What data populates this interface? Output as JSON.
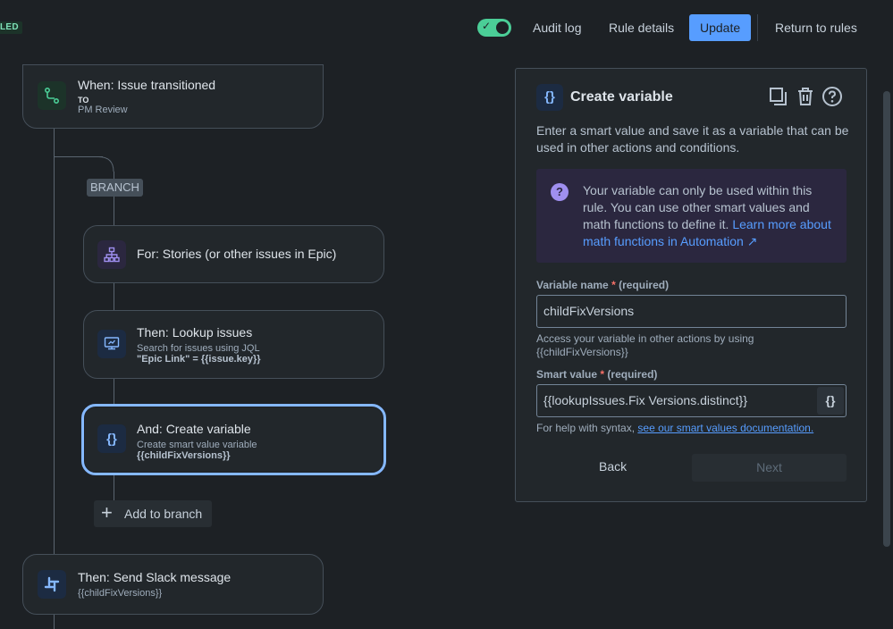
{
  "header": {
    "status_badge": "LED",
    "audit_log": "Audit log",
    "rule_details": "Rule details",
    "update": "Update",
    "return_to_rules": "Return to rules",
    "toggle_on": true,
    "toggle_check": "✓"
  },
  "flow": {
    "trigger": {
      "title": "When: Issue transitioned",
      "to_label": "TO",
      "status": "PM Review"
    },
    "branch_label": "BRANCH",
    "branch_for": {
      "title": "For: Stories (or other issues in Epic)"
    },
    "lookup": {
      "title": "Then: Lookup issues",
      "subtitle": "Search for issues using JQL",
      "jql": "\"Epic Link\" = {{issue.key}}"
    },
    "create_variable": {
      "title": "And: Create variable",
      "subtitle": "Create smart value variable",
      "value": "{{childFixVersions}}"
    },
    "add_to_branch": "Add to branch",
    "add_icon": "+",
    "slack": {
      "title": "Then: Send Slack message",
      "subtitle": "{{childFixVersions}}"
    }
  },
  "panel": {
    "icon": "{}",
    "title": "Create variable",
    "description": "Enter a smart value and save it as a variable that can be used in other actions and conditions.",
    "info_icon": "?",
    "info_text": "Your variable can only be used within this rule. You can use other smart values and math functions to define it. ",
    "info_link": "Learn more about math functions in Automation ↗",
    "variable_name_label": "Variable name",
    "smart_value_label": "Smart value",
    "required_star": "*",
    "required_text": "(required)",
    "variable_name_value": "childFixVersions",
    "variable_help": "Access your variable in other actions by using {{childFixVersions}}",
    "smart_value_value": "{{lookupIssues.Fix Versions.distinct}}",
    "smart_value_btn": "{}",
    "syntax_help": "For help with syntax, ",
    "syntax_link": "see our smart values documentation.",
    "back": "Back",
    "next": "Next"
  },
  "colors": {
    "background": "#1d2125",
    "accent": "#579dff",
    "selected_border": "#85b8ff",
    "toggle": "#4bce97"
  }
}
